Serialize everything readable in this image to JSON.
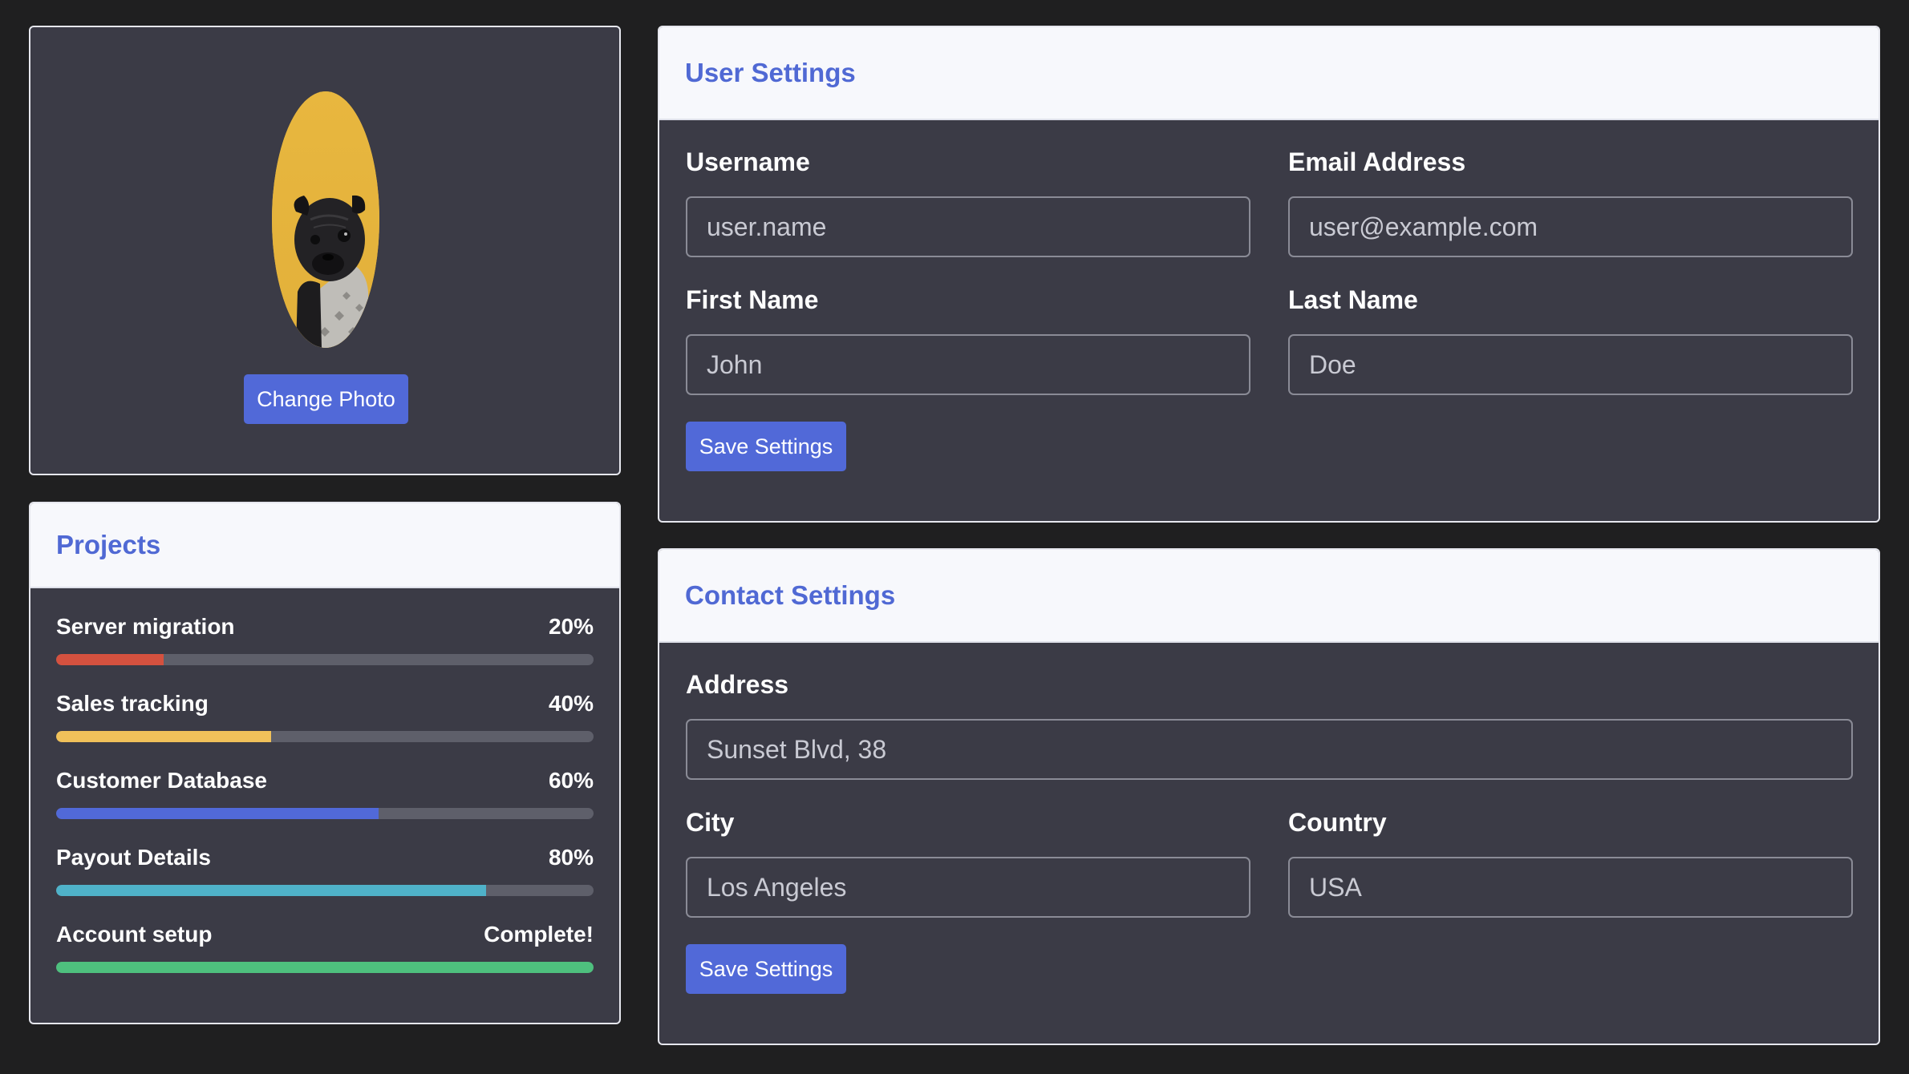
{
  "profile": {
    "change_photo_label": "Change Photo",
    "avatar_bg": "#e4b53e"
  },
  "projects": {
    "title": "Projects",
    "items": [
      {
        "name": "Server migration",
        "value_label": "20%",
        "progress": 0.2,
        "color": "#d4513f"
      },
      {
        "name": "Sales tracking",
        "value_label": "40%",
        "progress": 0.4,
        "color": "#f0c15a"
      },
      {
        "name": "Customer Database",
        "value_label": "60%",
        "progress": 0.6,
        "color": "#5169d8"
      },
      {
        "name": "Payout Details",
        "value_label": "80%",
        "progress": 0.8,
        "color": "#4fb2c9"
      },
      {
        "name": "Account setup",
        "value_label": "Complete!",
        "progress": 1.0,
        "color": "#4ec07e"
      }
    ]
  },
  "user_settings": {
    "title": "User Settings",
    "username_label": "Username",
    "username_placeholder": "user.name",
    "email_label": "Email Address",
    "email_placeholder": "user@example.com",
    "first_name_label": "First Name",
    "first_name_placeholder": "John",
    "last_name_label": "Last Name",
    "last_name_placeholder": "Doe",
    "save_label": "Save Settings"
  },
  "contact_settings": {
    "title": "Contact Settings",
    "address_label": "Address",
    "address_placeholder": "Sunset Blvd, 38",
    "city_label": "City",
    "city_placeholder": "Los Angeles",
    "country_label": "Country",
    "country_placeholder": "USA",
    "save_label": "Save Settings"
  },
  "colors": {
    "accent": "#5169d8",
    "header_text": "#5069d4",
    "card_bg": "#3b3b46",
    "page_bg": "#1f1f20"
  }
}
